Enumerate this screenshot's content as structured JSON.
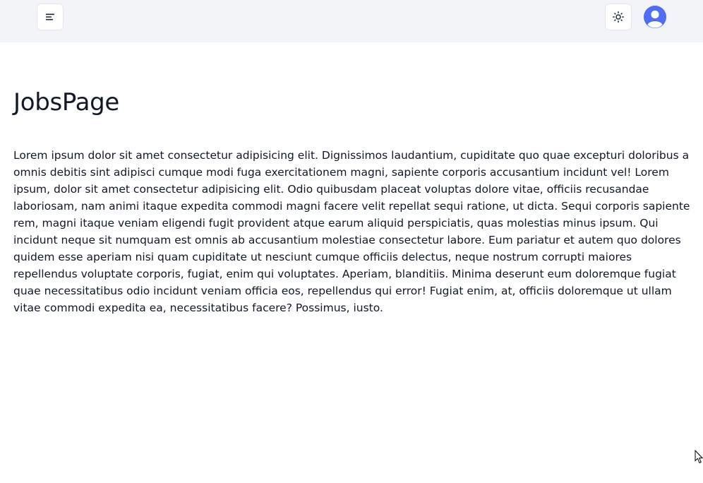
{
  "header": {
    "menu_icon": "menu-lines-icon",
    "theme_icon": "sun-icon",
    "avatar_icon": "user-avatar-icon",
    "accent_color": "#4f6ef5"
  },
  "main": {
    "title": "JobsPage",
    "body": "Lorem ipsum dolor sit amet consectetur adipisicing elit. Dignissimos laudantium, cupiditate quo quae excepturi doloribus a omnis debitis sint adipisci cumque modi fuga exercitationem magni, sapiente corporis accusantium incidunt vel! Lorem ipsum, dolor sit amet consectetur adipisicing elit. Odio quibusdam placeat voluptas dolore vitae, officiis recusandae laboriosam, nam animi itaque expedita commodi magni facere velit repellat sequi ratione, ut dicta. Sequi corporis sapiente rem, magni itaque veniam eligendi fugit provident atque earum aliquid perspiciatis, quas molestias minus ipsum. Qui incidunt neque sit numquam est omnis ab accusantium molestiae consectetur labore. Eum pariatur et autem quo dolores quidem esse aperiam nisi quam cupiditate ut nesciunt cumque officiis delectus, neque nostrum corrupti maiores repellendus voluptate corporis, fugiat, enim qui voluptates. Aperiam, blanditiis. Minima deserunt eum doloremque fugiat quae necessitatibus odio incidunt veniam officia eos, repellendus qui error! Fugiat enim, at, officiis doloremque ut ullam vitae commodi expedita ea, necessitatibus facere? Possimus, iusto."
  },
  "cursor": {
    "icon": "mouse-pointer-icon"
  }
}
